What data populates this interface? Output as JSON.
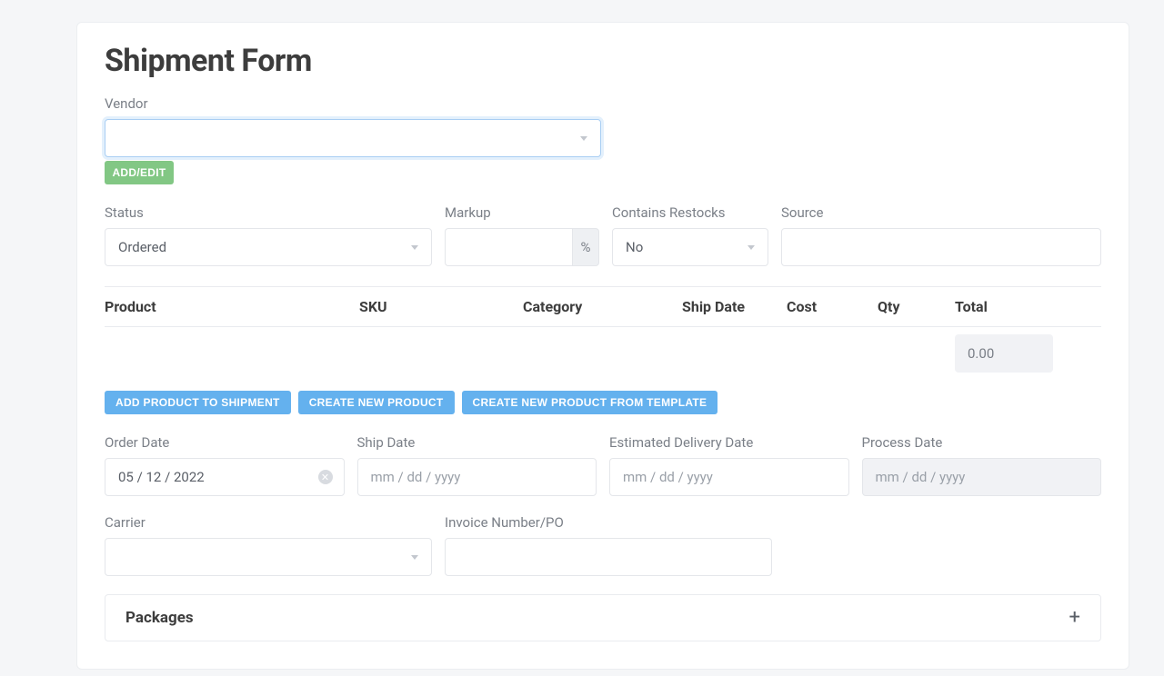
{
  "title": "Shipment Form",
  "vendor": {
    "label": "Vendor",
    "value": "",
    "add_edit": "ADD/EDIT"
  },
  "status": {
    "label": "Status",
    "value": "Ordered"
  },
  "markup": {
    "label": "Markup",
    "value": "",
    "suffix": "%"
  },
  "restocks": {
    "label": "Contains Restocks",
    "value": "No"
  },
  "source": {
    "label": "Source",
    "value": ""
  },
  "table": {
    "headers": {
      "product": "Product",
      "sku": "SKU",
      "category": "Category",
      "ship_date": "Ship Date",
      "cost": "Cost",
      "qty": "Qty",
      "total": "Total"
    },
    "total_value": "0.00"
  },
  "actions": {
    "add_product": "ADD PRODUCT TO SHIPMENT",
    "create_product": "CREATE NEW PRODUCT",
    "create_from_template": "CREATE NEW PRODUCT FROM TEMPLATE"
  },
  "dates": {
    "order": {
      "label": "Order Date",
      "value": "05 / 12 / 2022"
    },
    "ship": {
      "label": "Ship Date",
      "placeholder": "mm / dd / yyyy"
    },
    "delivery": {
      "label": "Estimated Delivery Date",
      "placeholder": "mm / dd / yyyy"
    },
    "process": {
      "label": "Process Date",
      "placeholder": "mm / dd / yyyy"
    }
  },
  "carrier": {
    "label": "Carrier",
    "value": ""
  },
  "invoice": {
    "label": "Invoice Number/PO",
    "value": ""
  },
  "packages": {
    "title": "Packages"
  }
}
